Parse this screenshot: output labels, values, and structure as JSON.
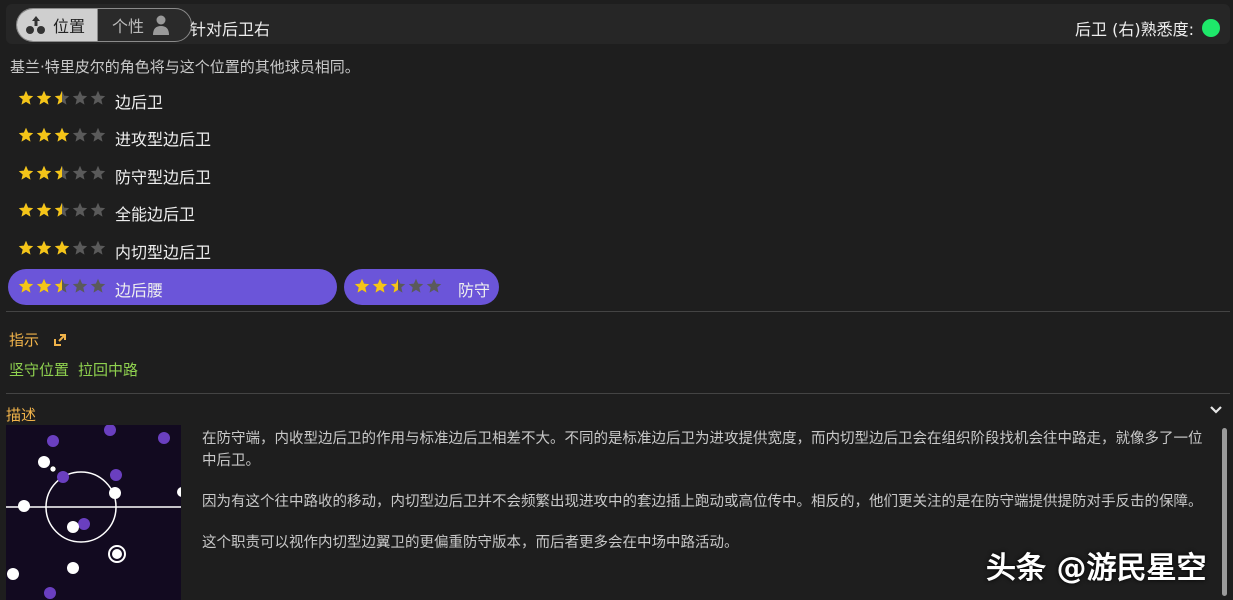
{
  "header": {
    "tab_position": "位置",
    "tab_personality": "个性",
    "title": "针对后卫右",
    "familiarity_label": "后卫 (右)熟悉度:",
    "familiarity_color": "#1ee86a"
  },
  "subtitle": "基兰·特里皮尔的角色将与这个位置的其他球员相同。",
  "roles": [
    {
      "label": "边后卫",
      "rating": 2.5,
      "selected": false
    },
    {
      "label": "进攻型边后卫",
      "rating": 3,
      "selected": false
    },
    {
      "label": "防守型边后卫",
      "rating": 2.5,
      "selected": false
    },
    {
      "label": "全能边后卫",
      "rating": 2.5,
      "selected": false
    },
    {
      "label": "内切型边后卫",
      "rating": 3,
      "selected": false
    },
    {
      "label": "边后腰",
      "rating": 2.5,
      "selected": true
    }
  ],
  "duty": {
    "label": "防守",
    "rating": 2.5,
    "selected": true
  },
  "instructions": {
    "title": "指示",
    "items": [
      "坚守位置",
      "拉回中路"
    ]
  },
  "description": {
    "title": "描述",
    "paragraphs": [
      "在防守端，内收型边后卫的作用与标准边后卫相差不大。不同的是标准边后卫为进攻提供宽度，而内切型边后卫会在组织阶段找机会往中路走，就像多了一位中后卫。",
      "因为有这个往中路收的移动，内切型边后卫并不会频繁出现进攻中的套边插上跑动或高位传中。相反的，他们更关注的是在防守端提供提防对手反击的保障。",
      "这个职责可以视作内切型边翼卫的更偏重防守版本，而后者更多会在中场中路活动。"
    ]
  },
  "watermark": "头条 @游民星空",
  "colors": {
    "accent_purple": "#6b55d9",
    "star_gold": "#f5c518",
    "star_empty": "#5a5a5a",
    "instruction_green": "#8fd14f",
    "section_orange": "#f0b34a"
  }
}
